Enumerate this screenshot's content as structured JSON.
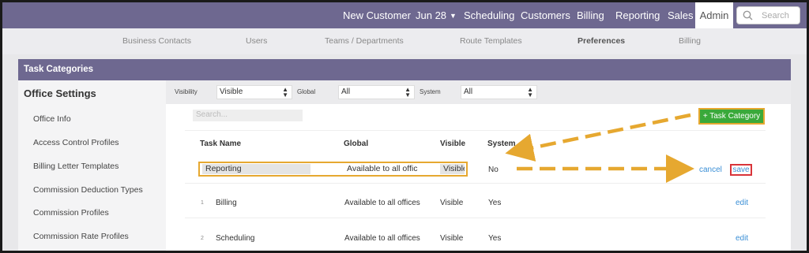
{
  "topnav": {
    "items": [
      "New Customer",
      "Jun 28",
      "Scheduling",
      "Customers",
      "Billing",
      "Reporting",
      "Sales",
      "Admin"
    ],
    "active": "Admin",
    "search_placeholder": "Search"
  },
  "subnav": {
    "items": [
      "Business Contacts",
      "Users",
      "Teams / Departments",
      "Route Templates",
      "Preferences",
      "Billing"
    ],
    "active": "Preferences"
  },
  "panel": {
    "title": "Task Categories"
  },
  "sidebar": {
    "title": "Office Settings",
    "items": [
      "Office Info",
      "Access Control Profiles",
      "Billing Letter Templates",
      "Commission Deduction Types",
      "Commission Profiles",
      "Commission Rate Profiles"
    ]
  },
  "filters": {
    "visibility_label": "Visibility",
    "visibility_value": "Visible",
    "global_label": "Global",
    "global_value": "All",
    "system_label": "System",
    "system_value": "All"
  },
  "table": {
    "search_placeholder": "Search...",
    "add_button": "+ Task Category",
    "headers": [
      "Task Name",
      "Global",
      "Visible",
      "System"
    ],
    "edit_row": {
      "name": "Reporting",
      "global": "Available to all offic",
      "visible": "Visible",
      "system": "No",
      "cancel": "cancel",
      "save": "save"
    },
    "rows": [
      {
        "num": "1",
        "name": "Billing",
        "global": "Available to all offices",
        "visible": "Visible",
        "system": "Yes",
        "action": "edit"
      },
      {
        "num": "2",
        "name": "Scheduling",
        "global": "Available to all offices",
        "visible": "Visible",
        "system": "Yes",
        "action": "edit"
      }
    ]
  },
  "colors": {
    "nav_bg": "#6e6890",
    "highlight": "#e6a830",
    "add_button": "#3aa93a",
    "save_border": "#d9343a",
    "link": "#3b8fd6"
  }
}
